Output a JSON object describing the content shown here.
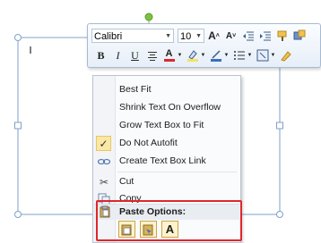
{
  "toolbar": {
    "font_name": "Calibri",
    "font_size": "10",
    "icons": {
      "grow_font": "grow-font-icon",
      "shrink_font": "shrink-font-icon",
      "decrease_indent": "decrease-indent-icon",
      "increase_indent": "increase-indent-icon",
      "format_painter": "format-painter-icon",
      "bold": "B",
      "italic": "I",
      "underline": "U",
      "center": "center-align-icon",
      "font_color": "A",
      "highlight": "highlight-icon",
      "line_color": "line-color-icon",
      "bullets": "bullets-icon"
    }
  },
  "menu": {
    "items": [
      {
        "label": "Best Fit"
      },
      {
        "label": "Shrink Text On Overflow"
      },
      {
        "label": "Grow Text Box to Fit"
      },
      {
        "label": "Do Not Autofit",
        "checked": true
      },
      {
        "label": "Create Text Box Link"
      },
      {
        "label": "Cut"
      },
      {
        "label": "Copy"
      }
    ],
    "paste_options_label": "Paste Options:"
  },
  "colors": {
    "highlight_border": "#e0262b",
    "selection_frame": "#7fa0c8",
    "rotation_handle": "#7cc242"
  }
}
